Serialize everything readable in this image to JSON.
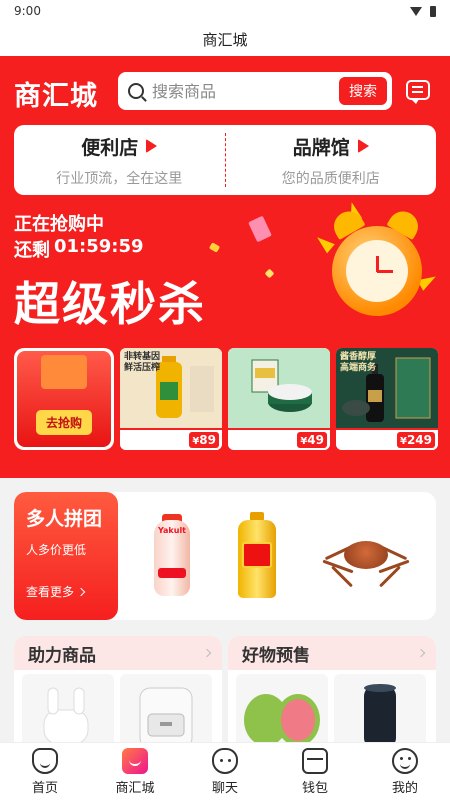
{
  "status_bar": {
    "time": "9:00"
  },
  "page_title": "商汇城",
  "header": {
    "logo": "商汇城",
    "search_placeholder": "搜索商品",
    "search_button": "搜索"
  },
  "stores": [
    {
      "title": "便利店",
      "subtitle": "行业顶流，全在这里"
    },
    {
      "title": "品牌馆",
      "subtitle": "您的品质便利店"
    }
  ],
  "flash_sale": {
    "status": "正在抢购中",
    "remaining_label": "还剩",
    "countdown": "01:59:59",
    "title": "超级秒杀",
    "go_button": "去抢购",
    "products": [
      {
        "tag": "非转基因 鲜活压榨",
        "price": "89"
      },
      {
        "tag": "",
        "price": "49"
      },
      {
        "tag": "酱香醇厚 高端商务",
        "price": "249"
      }
    ]
  },
  "group_buy": {
    "title": "多人拼团",
    "subtitle": "人多价更低",
    "more": "查看更多",
    "items": [
      "Yakult",
      "oil",
      "crab"
    ]
  },
  "sections": [
    {
      "title": "助力商品"
    },
    {
      "title": "好物预售"
    }
  ],
  "bottom_nav": [
    {
      "label": "首页",
      "icon": "home-icon"
    },
    {
      "label": "商汇城",
      "icon": "mall-icon"
    },
    {
      "label": "聊天",
      "icon": "chat-icon"
    },
    {
      "label": "钱包",
      "icon": "wallet-icon"
    },
    {
      "label": "我的",
      "icon": "profile-icon"
    }
  ],
  "colors": {
    "brand": "#f51f1f",
    "accent": "#ffd84a"
  }
}
